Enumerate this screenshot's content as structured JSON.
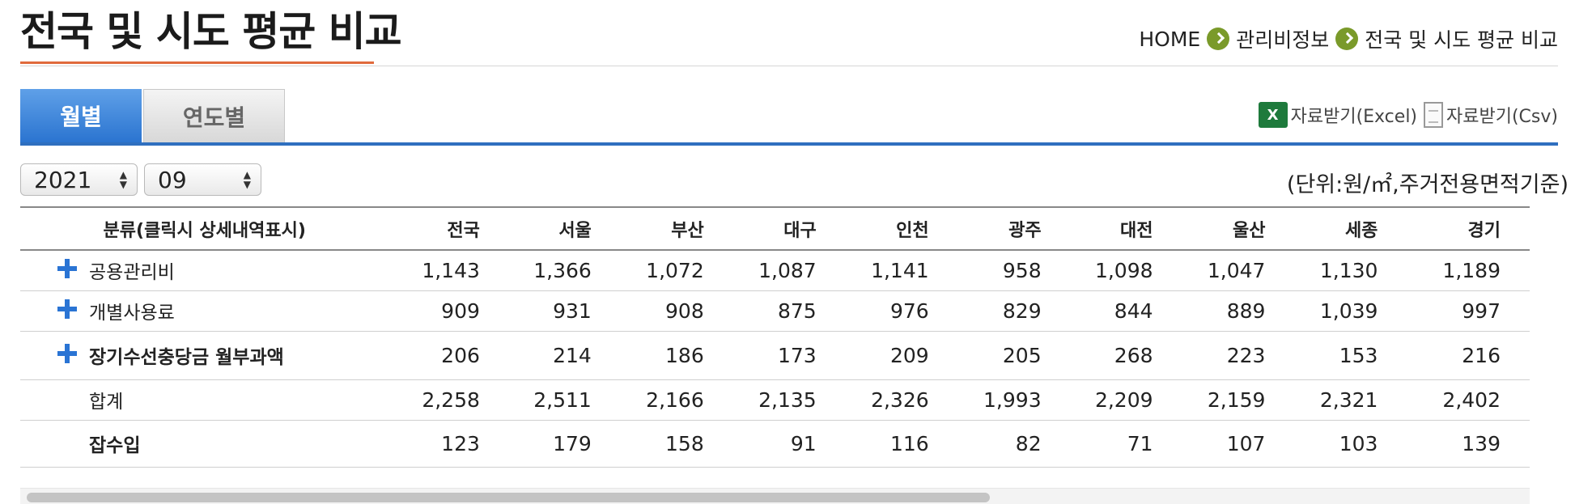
{
  "page": {
    "title": "전국 및 시도 평균 비교",
    "breadcrumb": [
      "HOME",
      "관리비정보",
      "전국 및 시도 평균 비교"
    ]
  },
  "tabs": [
    {
      "label": "월별",
      "active": true
    },
    {
      "label": "연도별",
      "active": false
    }
  ],
  "downloads": {
    "excel_label": "자료받기(Excel)",
    "excel_icon_text": "X",
    "csv_label": "자료받기(Csv)"
  },
  "filters": {
    "year": "2021",
    "month": "09"
  },
  "unit_note": "(단위:원/㎡,주거전용면적기준)",
  "table": {
    "headers": [
      "분류(클릭시 상세내역표시)",
      "전국",
      "서울",
      "부산",
      "대구",
      "인천",
      "광주",
      "대전",
      "울산",
      "세종",
      "경기"
    ],
    "rows": [
      {
        "label": "공용관리비",
        "values": [
          "1,143",
          "1,366",
          "1,072",
          "1,087",
          "1,141",
          "958",
          "1,098",
          "1,047",
          "1,130",
          "1,189"
        ]
      },
      {
        "label": "개별사용료",
        "values": [
          "909",
          "931",
          "908",
          "875",
          "976",
          "829",
          "844",
          "889",
          "1,039",
          "997"
        ]
      },
      {
        "label": "장기수선충당금 월부과액",
        "values": [
          "206",
          "214",
          "186",
          "173",
          "209",
          "205",
          "268",
          "223",
          "153",
          "216"
        ]
      },
      {
        "label": "합계",
        "values": [
          "2,258",
          "2,511",
          "2,166",
          "2,135",
          "2,326",
          "1,993",
          "2,209",
          "2,159",
          "2,321",
          "2,402"
        ]
      },
      {
        "label": "잡수입",
        "values": [
          "123",
          "179",
          "158",
          "91",
          "116",
          "82",
          "71",
          "107",
          "103",
          "139"
        ]
      }
    ]
  },
  "colors": {
    "accent_blue": "#2f6fbf",
    "title_underline": "#e06a3c",
    "breadcrumb_icon": "#7a9a2a",
    "plus_icon": "#2a74d4"
  }
}
